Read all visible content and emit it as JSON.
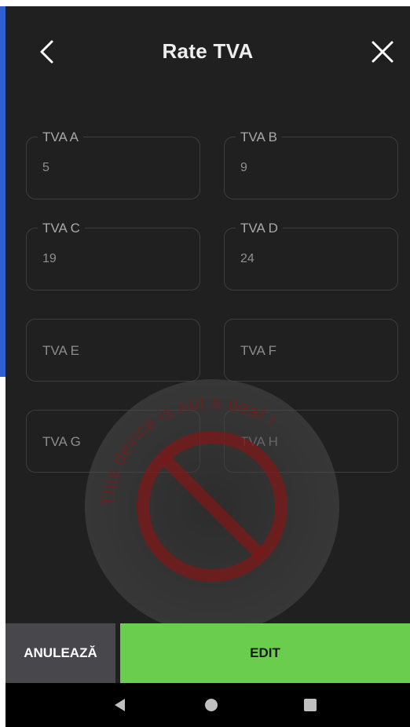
{
  "header": {
    "title": "Rate TVA",
    "back_icon": "chevron-left-icon",
    "close_icon": "close-icon"
  },
  "fields": [
    {
      "label": "TVA A",
      "value": "5"
    },
    {
      "label": "TVA B",
      "value": "9"
    },
    {
      "label": "TVA C",
      "value": "19"
    },
    {
      "label": "TVA D",
      "value": "24"
    },
    {
      "label": "TVA E",
      "value": ""
    },
    {
      "label": "TVA F",
      "value": ""
    },
    {
      "label": "TVA G",
      "value": ""
    },
    {
      "label": "TVA H",
      "value": ""
    }
  ],
  "watermark": {
    "text": "This device is not a deal ! ",
    "icon": "prohibited-icon"
  },
  "actions": {
    "cancel_label": "ANULEAZĂ",
    "edit_label": "EDIT"
  },
  "navbar": {
    "back_icon": "nav-back-icon",
    "home_icon": "nav-home-icon",
    "recents_icon": "nav-recents-icon"
  },
  "colors": {
    "background": "#202020",
    "accent_green": "#6acd4e",
    "cancel_gray": "#48484c",
    "side_accent": "#2f5fd0",
    "watermark_red": "#8b1a1a"
  }
}
